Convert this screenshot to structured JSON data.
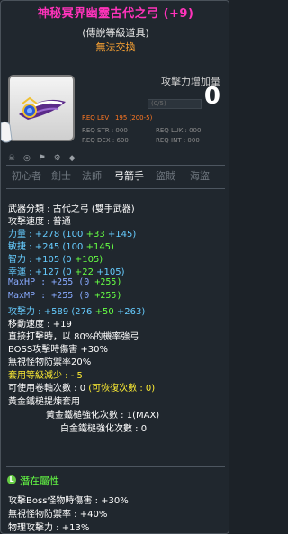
{
  "header": {
    "title": "神秘冥界幽靈古代之弓 (+9)",
    "grade": "(傳說等級道具)",
    "trade": "無法交換"
  },
  "attack_gain": {
    "label": "攻擊力增加量",
    "value": "0"
  },
  "requirements": {
    "rows": [
      {
        "left": "REQ LEV : 195 (200-5)",
        "right": "",
        "highlight": true
      },
      {
        "left": "REQ STR : 000",
        "right": "REQ LUK : 000",
        "highlight": false
      },
      {
        "left": "REQ DEX : 600",
        "right": "REQ INT : 000",
        "highlight": false
      }
    ],
    "bar_text": "(0/5)"
  },
  "job_tabs": [
    "初心者",
    "劍士",
    "法師",
    "弓箭手",
    "盜賊",
    "海盜"
  ],
  "active_job": "弓箭手",
  "stats": {
    "weapon_type": "武器分類 : 古代之弓 (雙手武器)",
    "attack_speed": "攻擊速度 : 普通",
    "str": {
      "label": "力量 : +278",
      "detail_a": "(100",
      "bonus": "+33",
      "detail_b": "+145)"
    },
    "dex": {
      "label": "敏捷 : +245",
      "detail_a": "(100",
      "bonus": "+145)",
      "detail_b": ""
    },
    "int": {
      "label": "智力 : +105",
      "detail_a": "(0",
      "bonus": "+105)",
      "detail_b": ""
    },
    "luk": {
      "label": "幸運 : +127",
      "detail_a": "(0",
      "bonus": "+22",
      "detail_b": "+105)"
    },
    "hp": {
      "label": "MaxHP : +255",
      "detail_a": "(0",
      "bonus": "+255)"
    },
    "mp": {
      "label": "MaxMP : +255",
      "detail_a": "(0",
      "bonus": "+255)"
    },
    "atk": {
      "label": "攻擊力 : +589",
      "detail_a": "(276",
      "bonus": "+50",
      "detail_b": "+263)"
    },
    "move_speed": "移動速度 : +19",
    "crit": "直接打擊時，以 80%的機率強弓",
    "boss": "BOSS攻擊時傷害 +30%",
    "ignore": "無視怪物防禦率20%",
    "level_reduce": "套用等級減少 : - 5",
    "upgrades": "可使用卷軸次數 : 0",
    "upgrades_recover": "(可恢復次數 : 0)",
    "hammer_title": "黃金鐵槌提煉套用",
    "gold_hammer": "黃金鐵槌強化次數 : 1(MAX)",
    "white_hammer": "白金鐵槌強化次數 : 0"
  },
  "potential": {
    "title": "潛在屬性",
    "lines": [
      "攻擊Boss怪物時傷害 : +30%",
      "無視怪物防禦率 : +40%",
      "物理攻擊力 : +13%"
    ]
  },
  "colors": {
    "title": "#ff33bb",
    "trade": "#ffa533",
    "stat_green": "#66ff44",
    "stat_blue": "#66ccff",
    "level_reduce": "#ffee33"
  }
}
